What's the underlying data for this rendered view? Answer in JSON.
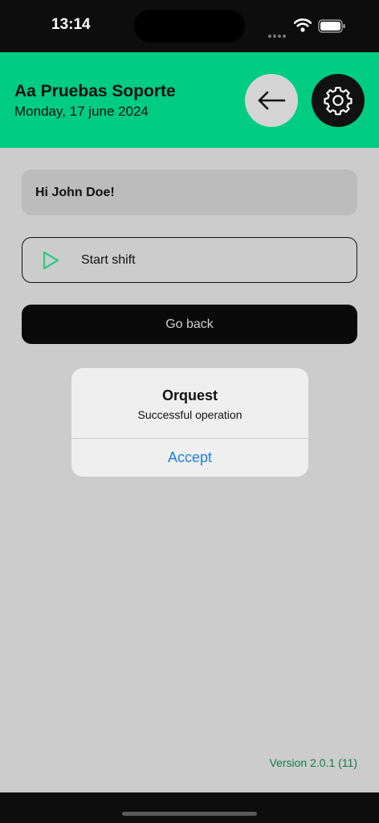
{
  "status_bar": {
    "time": "13:14",
    "icons": [
      "signal-dots-icon",
      "wifi-icon",
      "battery-icon"
    ]
  },
  "header": {
    "title": "Aa Pruebas Soporte",
    "date": "Monday, 17 june 2024",
    "back_icon": "arrow-left-icon",
    "settings_icon": "gear-icon"
  },
  "main": {
    "greeting": "Hi John Doe!",
    "start_shift_label": "Start shift",
    "start_shift_icon": "play-icon",
    "go_back_label": "Go back"
  },
  "dialog": {
    "title": "Orquest",
    "message": "Successful operation",
    "accept_label": "Accept"
  },
  "footer": {
    "version": "Version 2.0.1 (11)"
  },
  "colors": {
    "brand_green": "#00cc83",
    "background": "#cccccc",
    "link_blue": "#1d7fe0",
    "version_green": "#117a4b"
  }
}
